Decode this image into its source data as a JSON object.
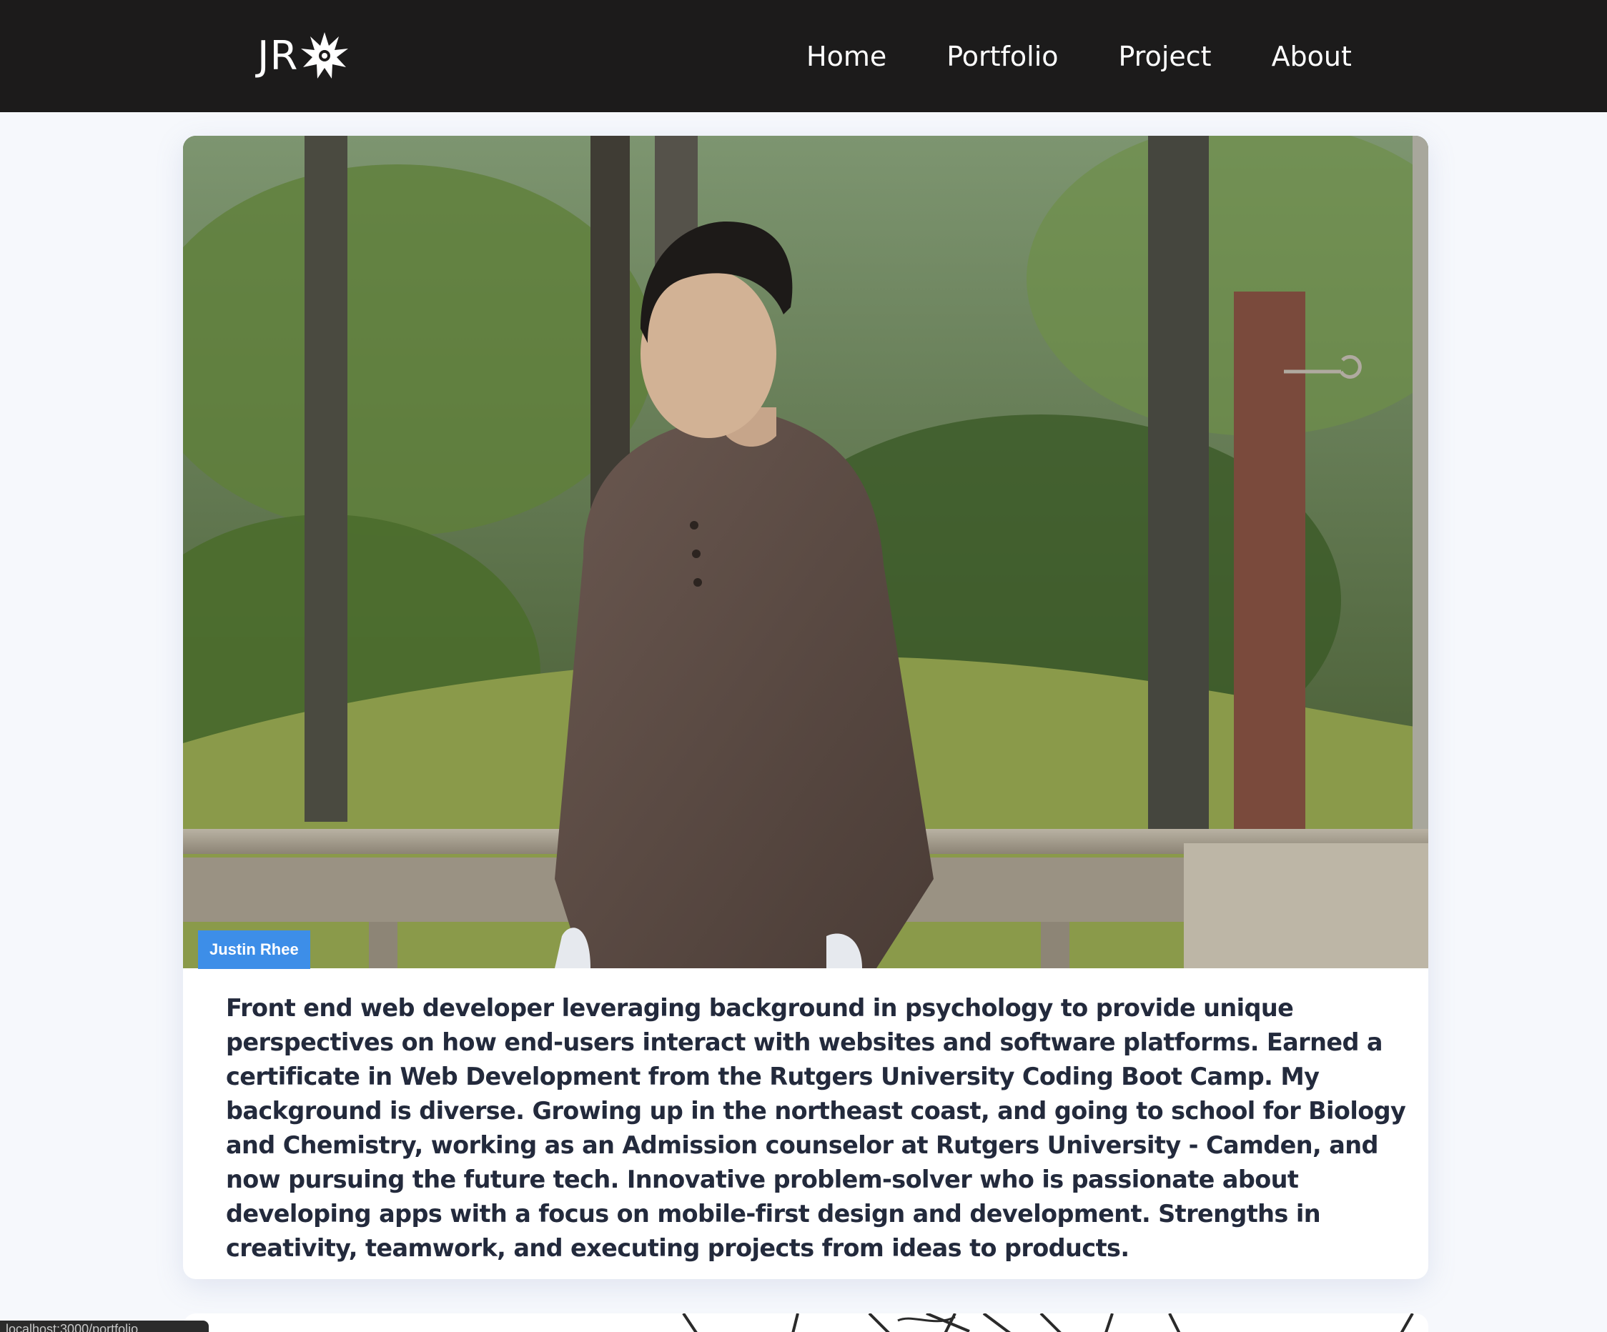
{
  "navbar": {
    "brand": "JR",
    "brand_icon": "starburst-icon",
    "links": [
      "Home",
      "Portfolio",
      "Project",
      "About"
    ]
  },
  "profile": {
    "photo_alt": "Justin Rhee",
    "name_tag": "Justin Rhee",
    "bio": "Front end web developer leveraging background in psychology to provide unique perspectives on how end-users interact with websites and software platforms. Earned a certificate in Web Development from the Rutgers University Coding Boot Camp. My background is diverse. Growing up in the northeast coast, and going to school for Biology and Chemistry, working as an Admission counselor at Rutgers University - Camden, and now pursuing the future tech. Innovative problem-solver who is passionate about developing apps with a focus on mobile-first design and development. Strengths in creativity, teamwork, and executing projects from ideas to products."
  },
  "status_bar": {
    "url": "localhost:3000/portfolio"
  },
  "colors": {
    "navbar_bg": "#1c1b1b",
    "name_tag_bg": "#3d8ee8",
    "bio_text": "#232a3c",
    "page_bg": "#f6f8fc"
  }
}
